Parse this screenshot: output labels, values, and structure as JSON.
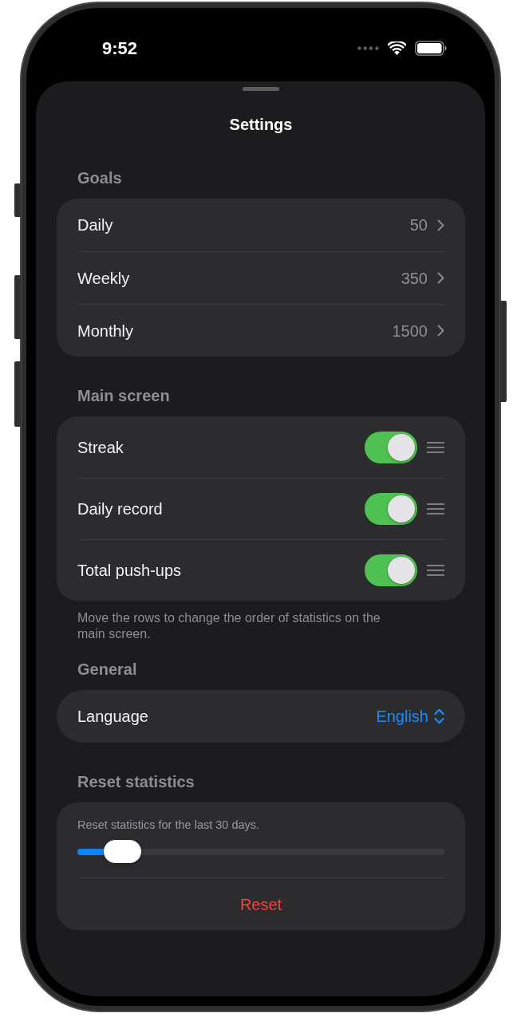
{
  "status_bar": {
    "time": "9:52"
  },
  "sheet": {
    "title": "Settings"
  },
  "sections": [
    {
      "kind": "list",
      "header": "Goals",
      "rows": [
        {
          "kind": "disclosure",
          "label": "Daily",
          "value": "50"
        },
        {
          "kind": "disclosure",
          "label": "Weekly",
          "value": "350"
        },
        {
          "kind": "disclosure",
          "label": "Monthly",
          "value": "1500"
        }
      ]
    },
    {
      "kind": "list",
      "header": "Main screen",
      "rows": [
        {
          "kind": "toggle",
          "label": "Streak",
          "on": true
        },
        {
          "kind": "toggle",
          "label": "Daily record",
          "on": true
        },
        {
          "kind": "toggle",
          "label": "Total push-ups",
          "on": true
        }
      ],
      "footer": "Move the rows to change the order of statistics on the main screen."
    },
    {
      "kind": "list",
      "header": "General",
      "rows": [
        {
          "kind": "picker",
          "label": "Language",
          "value": "English"
        }
      ]
    },
    {
      "kind": "slider",
      "header": "Reset statistics",
      "caption": "Reset statistics for the last 30 days.",
      "level": 0.08,
      "action": "Reset"
    }
  ]
}
